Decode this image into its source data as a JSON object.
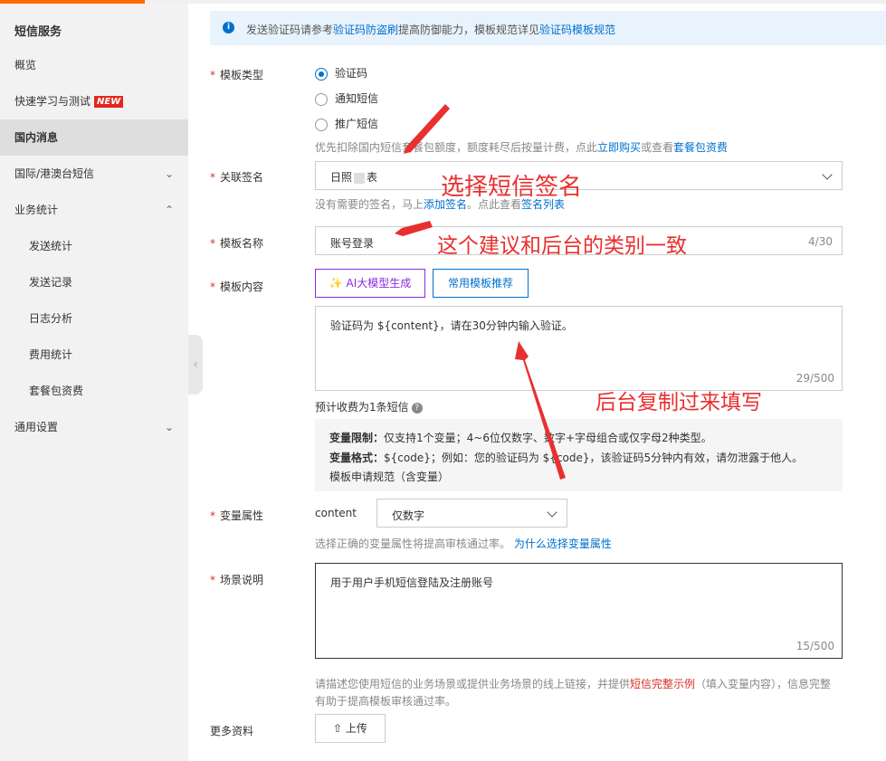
{
  "sidebar": {
    "title": "短信服务",
    "items": [
      {
        "label": "概览"
      },
      {
        "label": "快速学习与测试",
        "badge": "NEW"
      },
      {
        "label": "国内消息"
      },
      {
        "label": "国际/港澳台短信"
      },
      {
        "label": "业务统计"
      },
      {
        "label": "发送统计"
      },
      {
        "label": "发送记录"
      },
      {
        "label": "日志分析"
      },
      {
        "label": "费用统计"
      },
      {
        "label": "套餐包资费"
      },
      {
        "label": "通用设置"
      }
    ]
  },
  "notice": {
    "prefix": "发送验证码请参考",
    "link1": "验证码防盗刷",
    "middle": "提高防御能力，模板规范详见",
    "link2": "验证码模板规范"
  },
  "template_type": {
    "label": "模板类型",
    "options": [
      "验证码",
      "通知短信",
      "推广短信"
    ],
    "selected": "验证码",
    "hint_prefix": "优先扣除国内短信套餐包额度，额度耗尽后按量计费，点此",
    "hint_link1": "立即购买",
    "hint_mid": "或查看",
    "hint_link2": "套餐包资费"
  },
  "signature": {
    "label": "关联签名",
    "value_start": "日照",
    "value_end": "表",
    "hint_prefix": "没有需要的签名，马上",
    "hint_link1": "添加签名",
    "hint_mid": "。点此查看",
    "hint_link2": "签名列表"
  },
  "template_name": {
    "label": "模板名称",
    "value": "账号登录",
    "counter": "4/30"
  },
  "template_content": {
    "label": "模板内容",
    "ai_button": "AI大模型生成",
    "tpl_button": "常用模板推荐",
    "value": "验证码为 ${content}，请在30分钟内输入验证。",
    "counter": "29/500",
    "estimate": "预计收费为1条短信",
    "rule1_title": "变量限制：",
    "rule1_text": "仅支持1个变量；4~6位仅数字、数字+字母组合或仅字母2种类型。",
    "rule2_title": "变量格式：",
    "rule2_text": "${code}；例如：您的验证码为 ${code}，该验证码5分钟内有效，请勿泄露于他人。",
    "rule_link": "模板申请规范（含变量）"
  },
  "variable": {
    "label": "变量属性",
    "name": "content",
    "type": "仅数字",
    "hint": "选择正确的变量属性将提高审核通过率。",
    "hint_link": "为什么选择变量属性"
  },
  "scene": {
    "label": "场景说明",
    "value": "用于用户手机短信登陆及注册账号",
    "counter": "15/500",
    "hint_prefix": "请描述您使用短信的业务场景或提供业务场景的线上链接，并提供",
    "hint_link": "短信完整示例",
    "hint_suffix": "（填入变量内容），信息完整",
    "hint_line2": "有助于提高模板审核通过率。"
  },
  "more": {
    "label": "更多资料",
    "upload": "上传"
  },
  "annotations": {
    "a1": "选择短信签名",
    "a2": "这个建议和后台的类别一致",
    "a3": "后台复制过来填写"
  }
}
